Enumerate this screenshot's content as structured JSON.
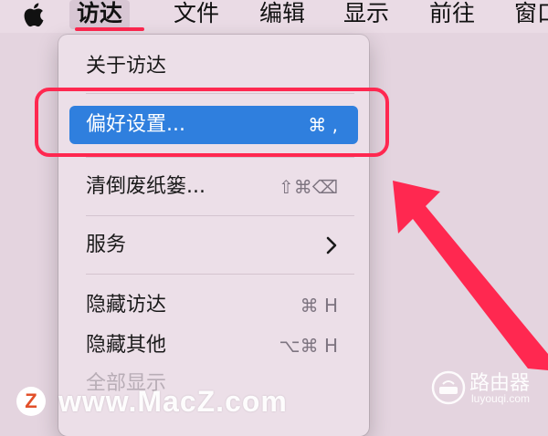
{
  "menubar": {
    "apple_icon": "apple-icon",
    "items": [
      {
        "label": "访达",
        "active": true
      },
      {
        "label": "文件"
      },
      {
        "label": "编辑"
      },
      {
        "label": "显示"
      },
      {
        "label": "前往"
      },
      {
        "label": "窗口"
      }
    ]
  },
  "menu": {
    "about": "关于访达",
    "preferences": {
      "label": "偏好设置...",
      "shortcut": "⌘ ,"
    },
    "empty_trash": {
      "label": "清倒废纸篓...",
      "shortcut": "⇧⌘⌫"
    },
    "services": {
      "label": "服务",
      "submenu_icon": "chevron-right-icon"
    },
    "hide_finder": {
      "label": "隐藏访达",
      "shortcut": "⌘ H"
    },
    "hide_others": {
      "label": "隐藏其他",
      "shortcut": "⌥⌘ H"
    },
    "show_all": {
      "label": "全部显示"
    }
  },
  "watermark": {
    "logo_letter": "Z",
    "site_left": "www.MacZ.com",
    "site_right_title": "路由器",
    "site_right_sub": "luyouqi.com"
  },
  "colors": {
    "selection": "#2f7fde",
    "annotation": "#ff2850",
    "background": "#e4d4df"
  }
}
